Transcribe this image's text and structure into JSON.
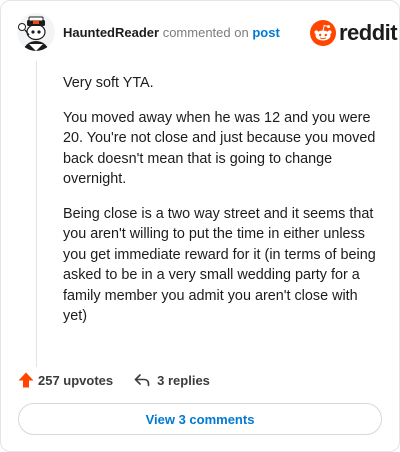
{
  "header": {
    "username": "HauntedReader",
    "commented_on": "commented on",
    "post_link": "post",
    "logo_text": "reddit"
  },
  "comment": {
    "paragraphs": [
      "Very soft YTA.",
      "You moved away when he was 12 and you were 20. You're not close and just because you moved back doesn't mean that is going to change overnight.",
      "Being close is a two way street and it seems that you aren't willing to put the time in either unless you get immediate reward for it (in terms of being asked to be in a very small wedding party for a family member you admit you aren't close with yet)"
    ]
  },
  "actions": {
    "upvotes": "257 upvotes",
    "replies": "3 replies"
  },
  "footer": {
    "view_comments": "View 3 comments"
  },
  "colors": {
    "reddit_orange": "#ff4500",
    "link_blue": "#0079d3"
  },
  "icons": [
    "avatar",
    "reddit-logo-icon",
    "upvote-icon",
    "reply-icon"
  ]
}
